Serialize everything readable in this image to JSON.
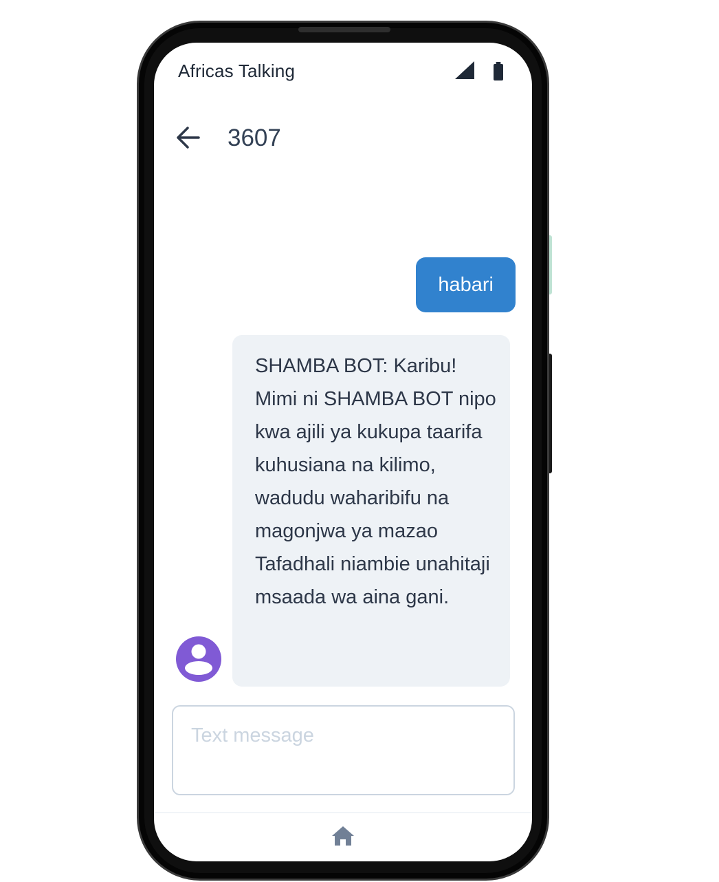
{
  "status_bar": {
    "carrier": "Africas Talking",
    "signal_icon": "cellular-signal-icon",
    "battery_icon": "battery-full-icon"
  },
  "header": {
    "back_icon": "arrow-left-icon",
    "title": "3607"
  },
  "messages": [
    {
      "direction": "outgoing",
      "text": "habari"
    },
    {
      "direction": "incoming",
      "text": "SHAMBA BOT: Karibu! Mimi ni SHAMBA BOT nipo kwa ajili ya kukupa taarifa kuhusiana na kilimo, wadudu waharibifu na magonjwa ya mazao Tafadhali niambie unahitaji msaada wa aina gani."
    }
  ],
  "composer": {
    "placeholder": "Text message",
    "value": ""
  },
  "bottom_nav": {
    "home_icon": "home-icon"
  },
  "colors": {
    "outgoing_bubble": "#3182ce",
    "incoming_bubble": "#eef2f6",
    "avatar": "#805ad5",
    "text_primary": "#2d3748"
  }
}
